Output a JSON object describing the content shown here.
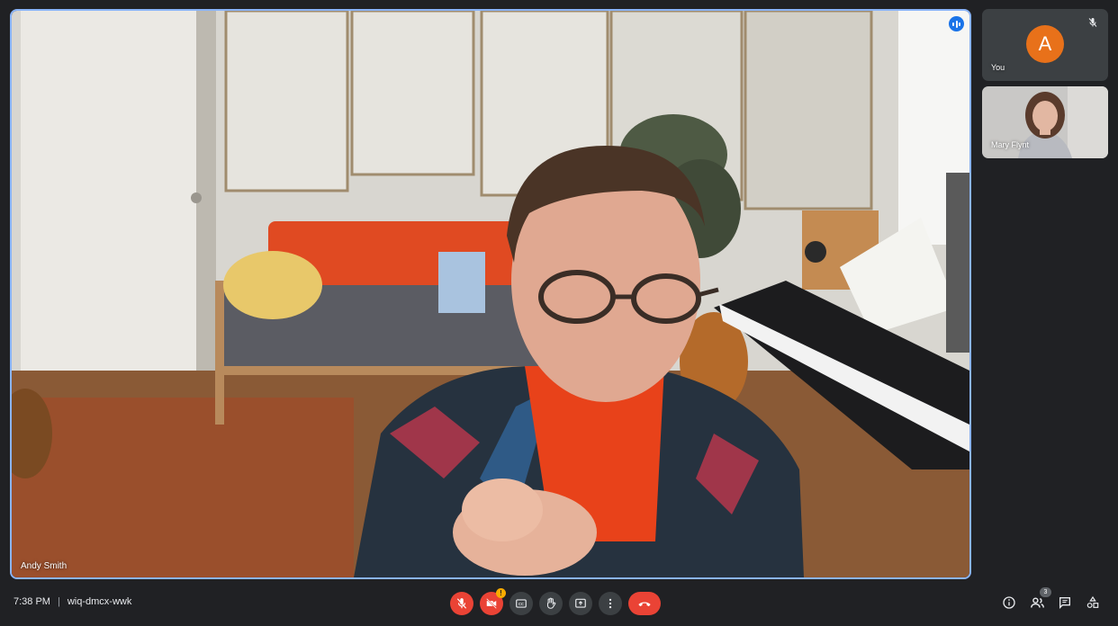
{
  "main_speaker": {
    "name": "Andy Smith"
  },
  "participants": [
    {
      "name": "You",
      "initial": "A",
      "muted": true,
      "avatar_color": "#e8711a"
    },
    {
      "name": "Mary Flynt"
    }
  ],
  "meeting": {
    "time": "7:38 PM",
    "separator": "|",
    "code": "wiq-dmcx-wwk"
  },
  "controls": [
    {
      "name": "microphone",
      "icon": "mic-off-icon",
      "state": "off"
    },
    {
      "name": "camera",
      "icon": "camera-off-icon",
      "state": "off",
      "warning_badge": "!"
    },
    {
      "name": "captions",
      "icon": "cc-icon"
    },
    {
      "name": "raise-hand",
      "icon": "hand-icon"
    },
    {
      "name": "present",
      "icon": "present-icon"
    },
    {
      "name": "more-options",
      "icon": "more-vert-icon"
    },
    {
      "name": "leave-call",
      "icon": "call-end-icon"
    }
  ],
  "side_controls": {
    "people_count": "3",
    "icons": [
      "info-icon",
      "people-icon",
      "chat-icon",
      "activities-icon"
    ]
  },
  "colors": {
    "accent": "#8ab4f8",
    "danger": "#ea4335",
    "background": "#202124"
  }
}
